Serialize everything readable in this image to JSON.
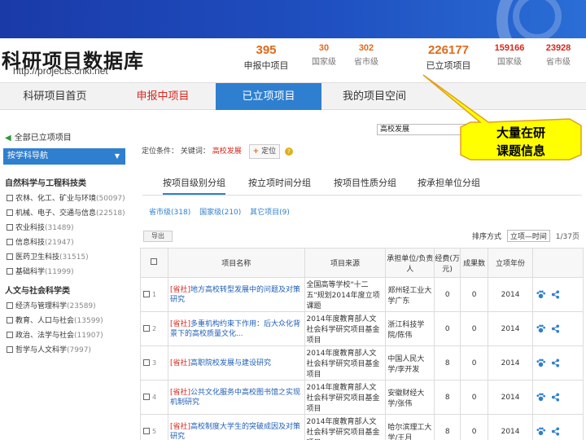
{
  "site": {
    "title": "科研项目数据库",
    "url": "http://projects.cnki.net"
  },
  "stats": [
    {
      "num": "395",
      "label": "申报中项目",
      "size": "big"
    },
    {
      "num": "30",
      "label": "国家级",
      "size": "small"
    },
    {
      "num": "302",
      "label": "省市级",
      "size": "small"
    },
    {
      "num": "226177",
      "label": "已立项项目",
      "size": "big"
    },
    {
      "num": "159166",
      "label": "国家级",
      "size": "small"
    },
    {
      "num": "23928",
      "label": "省市级",
      "size": "small"
    }
  ],
  "nav": {
    "tabs": [
      {
        "label": "科研项目首页",
        "state": "normal"
      },
      {
        "label": "申报中项目",
        "state": "red"
      },
      {
        "label": "已立项项目",
        "state": "active"
      },
      {
        "label": "我的项目空间",
        "state": "normal"
      }
    ]
  },
  "sidebar": {
    "back_label": "全部已立项项目",
    "subject_select": "按学科导航",
    "section1": "自然科学与工程科技类",
    "items1": [
      {
        "name": "农林、化工、矿业与环境",
        "count": "(50097)"
      },
      {
        "name": "机械、电子、交通与信息",
        "count": "(22518)"
      },
      {
        "name": "农业科技",
        "count": "(31489)"
      },
      {
        "name": "信息科技",
        "count": "(21947)"
      },
      {
        "name": "医药卫生科技",
        "count": "(31515)"
      },
      {
        "name": "基础科学",
        "count": "(11999)"
      }
    ],
    "section2": "人文与社会科学类",
    "items2": [
      {
        "name": "经济与管理科学",
        "count": "(23589)"
      },
      {
        "name": "教育、人口与社会",
        "count": "(13599)"
      },
      {
        "name": "政治、法学与社会",
        "count": "(11907)"
      },
      {
        "name": "哲学与人文科学",
        "count": "(7997)"
      }
    ]
  },
  "search": {
    "value": "高校发展"
  },
  "condition": {
    "prefix": "定位条件：",
    "field": "关键词：",
    "value": "高校发展",
    "add_label": "定位"
  },
  "group_tabs": [
    {
      "label": "按项目级别分组"
    },
    {
      "label": "按立项时间分组"
    },
    {
      "label": "按项目性质分组"
    },
    {
      "label": "按承担单位分组"
    }
  ],
  "subgroups": [
    "省市级(318)",
    "国家级(210)",
    "其它项目(9)"
  ],
  "toolbar": {
    "export_label": "导出",
    "sort_label": "排序方式",
    "sort_value": "立项—时间",
    "page_label": "1/37页"
  },
  "table": {
    "headers": [
      "项目名称",
      "项目来源",
      "承担单位/负责人",
      "经费(万元)",
      "成果数",
      "立项年份"
    ],
    "rows": [
      {
        "n": "1",
        "tag": "[省社]",
        "title": "地方高校转型发展中的问题及对策研究",
        "source": "全国高等学校\"十二五\"规划2014年度立项课题",
        "unit": "郑州轻工业大学广东",
        "fund": "0",
        "results": "0",
        "year": "2014"
      },
      {
        "n": "2",
        "tag": "[省社]",
        "title": "多重机构约束下作用：后大众化背景下的高校质量文化...",
        "source": "2014年度教育部人文社会科学研究项目基金项目",
        "unit": "浙江科技学院/陈伟",
        "fund": "0",
        "results": "0",
        "year": "2014"
      },
      {
        "n": "3",
        "tag": "[省社]",
        "title": "高职院校发展与建设研究",
        "source": "2014年度教育部人文社会科学研究项目基金项目",
        "unit": "中国人民大学/李开发",
        "fund": "8",
        "results": "0",
        "year": "2014"
      },
      {
        "n": "4",
        "tag": "[省社]",
        "title": "公共文化服务中高校图书馆之实现机制研究",
        "source": "2014年度教育部人文社会科学研究项目基金项目",
        "unit": "安徽财经大学/张伟",
        "fund": "8",
        "results": "0",
        "year": "2014"
      },
      {
        "n": "5",
        "tag": "[省社]",
        "title": "高校制度大学生的突破成因及对策研究",
        "source": "2014年度教育部人文社会科学研究项目基金项目",
        "unit": "哈尔滨理工大学/王月",
        "fund": "8",
        "results": "0",
        "year": "2014"
      }
    ]
  },
  "callout": {
    "line1": "大量在研",
    "line2": "课题信息"
  },
  "colors": {
    "accent": "#2f7fd0",
    "red": "#d6281e",
    "orange": "#e06a1a",
    "callout_fill": "#ffff00",
    "callout_stroke": "#e0a020"
  }
}
